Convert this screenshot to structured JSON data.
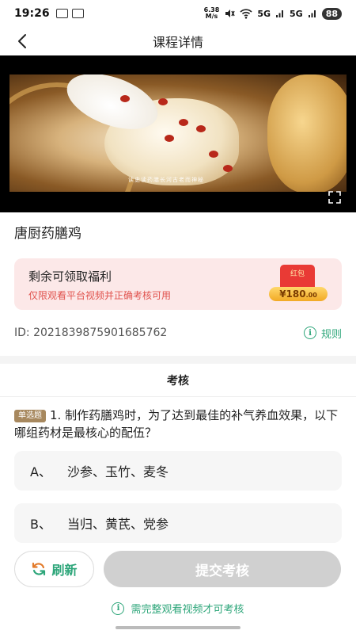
{
  "status_bar": {
    "time": "19:26",
    "net_speed_top": "6.38",
    "net_speed_bottom": "M/s",
    "signal_1": "5G",
    "signal_2": "5G",
    "battery": "88"
  },
  "nav": {
    "title": "课程详情"
  },
  "video": {
    "caption": "读史读药膳长河古老而神秘"
  },
  "course": {
    "title": "唐厨药膳鸡",
    "id_text": "ID: 2021839875901685762",
    "rules_label": "规则"
  },
  "benefit": {
    "title": "剩余可领取福利",
    "subtitle": "仅限观看平台视频并正确考核可用",
    "redpacket_label": "红包",
    "amount_main": "¥180",
    "amount_decimal": ".00"
  },
  "tabs": {
    "exam": "考核"
  },
  "question": {
    "tag": "单选题",
    "text": "1. 制作药膳鸡时，为了达到最佳的补气养血效果，以下哪组药材是最核心的配伍？",
    "options": [
      {
        "key": "A、",
        "text": "沙参、玉竹、麦冬"
      },
      {
        "key": "B、",
        "text": "当归、黄芪、党参"
      }
    ]
  },
  "bottom": {
    "refresh_label": "刷新",
    "submit_label": "提交考核",
    "notice": "需完整观看视频才可考核"
  },
  "colors": {
    "accent": "#2ea67a",
    "warning_text": "#e0524d",
    "card_bg": "#fce8e8",
    "disabled_button": "#d0d0d0"
  }
}
